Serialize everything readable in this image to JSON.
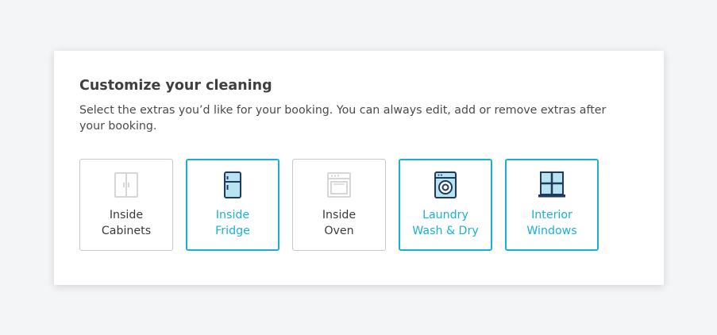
{
  "section": {
    "title": "Customize your cleaning",
    "subtitle": "Select the extras you’d like for your booking. You can always edit, add or remove extras after your booking."
  },
  "extras": [
    {
      "label": "Inside\nCabinets",
      "icon": "cabinet-icon",
      "selected": false
    },
    {
      "label": "Inside\nFridge",
      "icon": "fridge-icon",
      "selected": true
    },
    {
      "label": "Inside\nOven",
      "icon": "oven-icon",
      "selected": false
    },
    {
      "label": "Laundry\nWash & Dry",
      "icon": "washing-machine-icon",
      "selected": true
    },
    {
      "label": "Interior\nWindows",
      "icon": "window-icon",
      "selected": true
    }
  ],
  "colors": {
    "accent": "#1ab0d3",
    "icon_dark": "#1f3a5c",
    "icon_fill": "#b8e4f2",
    "inactive": "#d6d6d6",
    "background": "#f4f5f7"
  }
}
